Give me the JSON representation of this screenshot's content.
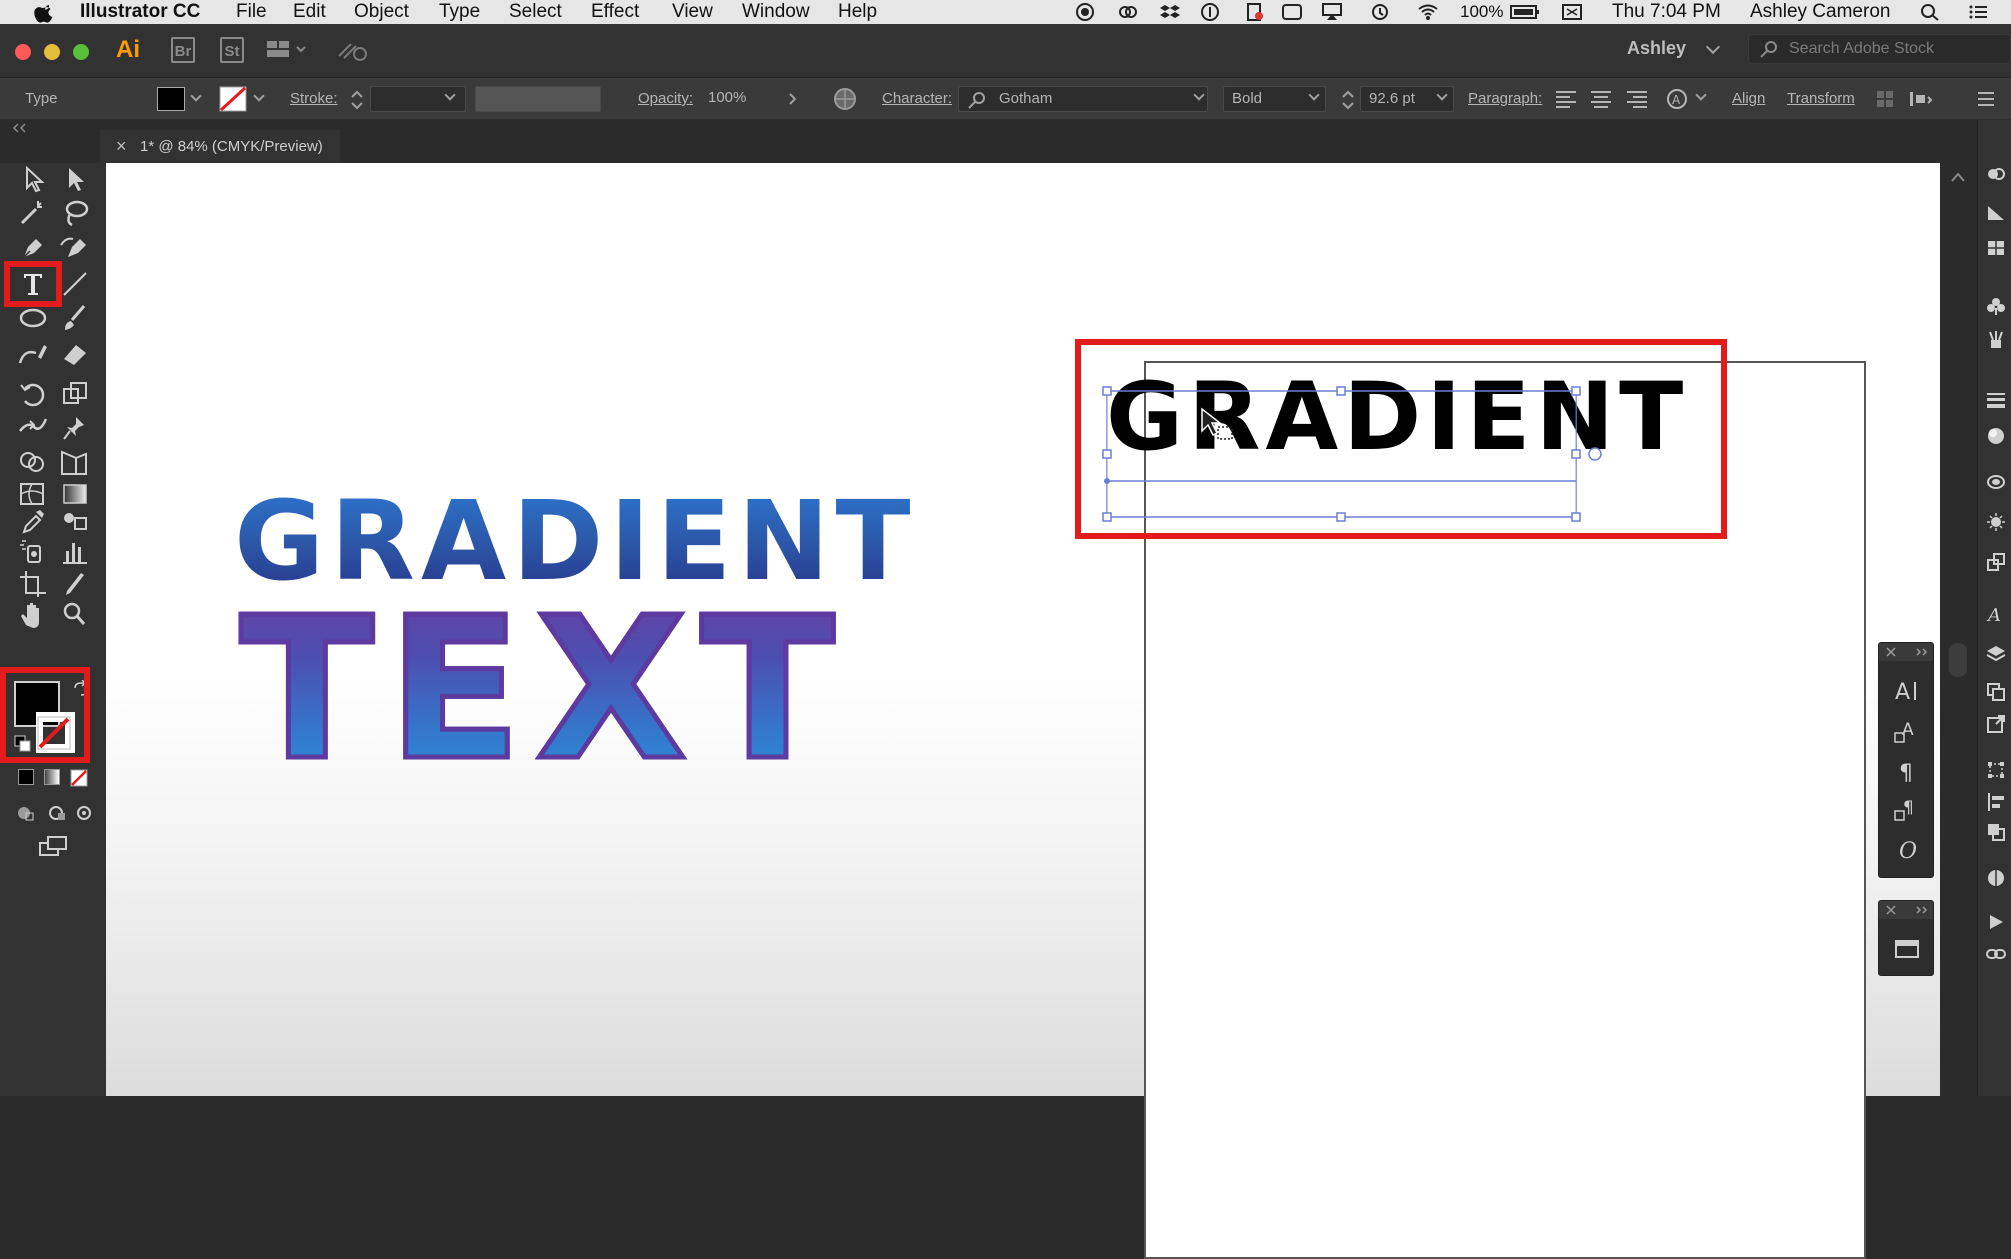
{
  "menubar": {
    "app_name": "Illustrator CC",
    "items": [
      "File",
      "Edit",
      "Object",
      "Type",
      "Select",
      "Effect",
      "View",
      "Window",
      "Help"
    ],
    "battery": "100%",
    "clock": "Thu 7:04 PM",
    "user": "Ashley Cameron"
  },
  "appbar": {
    "logo": "Ai",
    "bridge": "Br",
    "stock": "St",
    "workspace": "Ashley",
    "search_placeholder": "Search Adobe Stock"
  },
  "controlbar": {
    "tool_label": "Type",
    "stroke_label": "Stroke:",
    "opacity_label": "Opacity:",
    "opacity_value": "100%",
    "character_label": "Character:",
    "font_family": "Gotham",
    "font_style": "Bold",
    "font_size": "92.6 pt",
    "paragraph_label": "Paragraph:",
    "align_label": "Align",
    "transform_label": "Transform"
  },
  "document_tab": {
    "close": "×",
    "title": "1* @ 84% (CMYK/Preview)"
  },
  "canvas": {
    "sample_line1": "GRADIENT",
    "sample_line2": "TEXT",
    "selected_text": "GRADIENT"
  },
  "colors": {
    "highlight": "#e31b1b",
    "gradient_top": "#2d78d0",
    "gradient_bottom": "#27338a",
    "text_outline": "#5c3aa0",
    "selection": "#6b7fd6"
  }
}
